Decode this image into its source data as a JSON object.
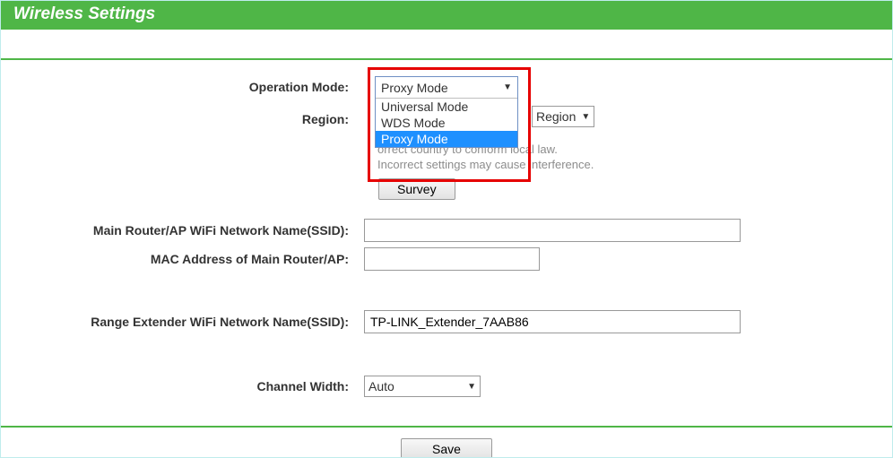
{
  "header": {
    "title": "Wireless Settings"
  },
  "operation_mode": {
    "label": "Operation Mode:",
    "selected": "Proxy Mode",
    "options": [
      "Universal Mode",
      "WDS Mode",
      "Proxy Mode"
    ],
    "highlighted": "Proxy Mode"
  },
  "region": {
    "label": "Region:",
    "select_display": "Region",
    "note_line1": "orrect country to conform local law.",
    "note_line2": "Incorrect settings may cause interference."
  },
  "survey": {
    "label": "Survey"
  },
  "main_ssid": {
    "label": "Main Router/AP WiFi Network Name(SSID):",
    "value": ""
  },
  "main_mac": {
    "label": "MAC Address of Main Router/AP:",
    "value": ""
  },
  "extender_ssid": {
    "label": "Range Extender WiFi Network Name(SSID):",
    "value": "TP-LINK_Extender_7AAB86"
  },
  "channel_width": {
    "label": "Channel Width:",
    "value": "Auto"
  },
  "save": {
    "label": "Save"
  }
}
